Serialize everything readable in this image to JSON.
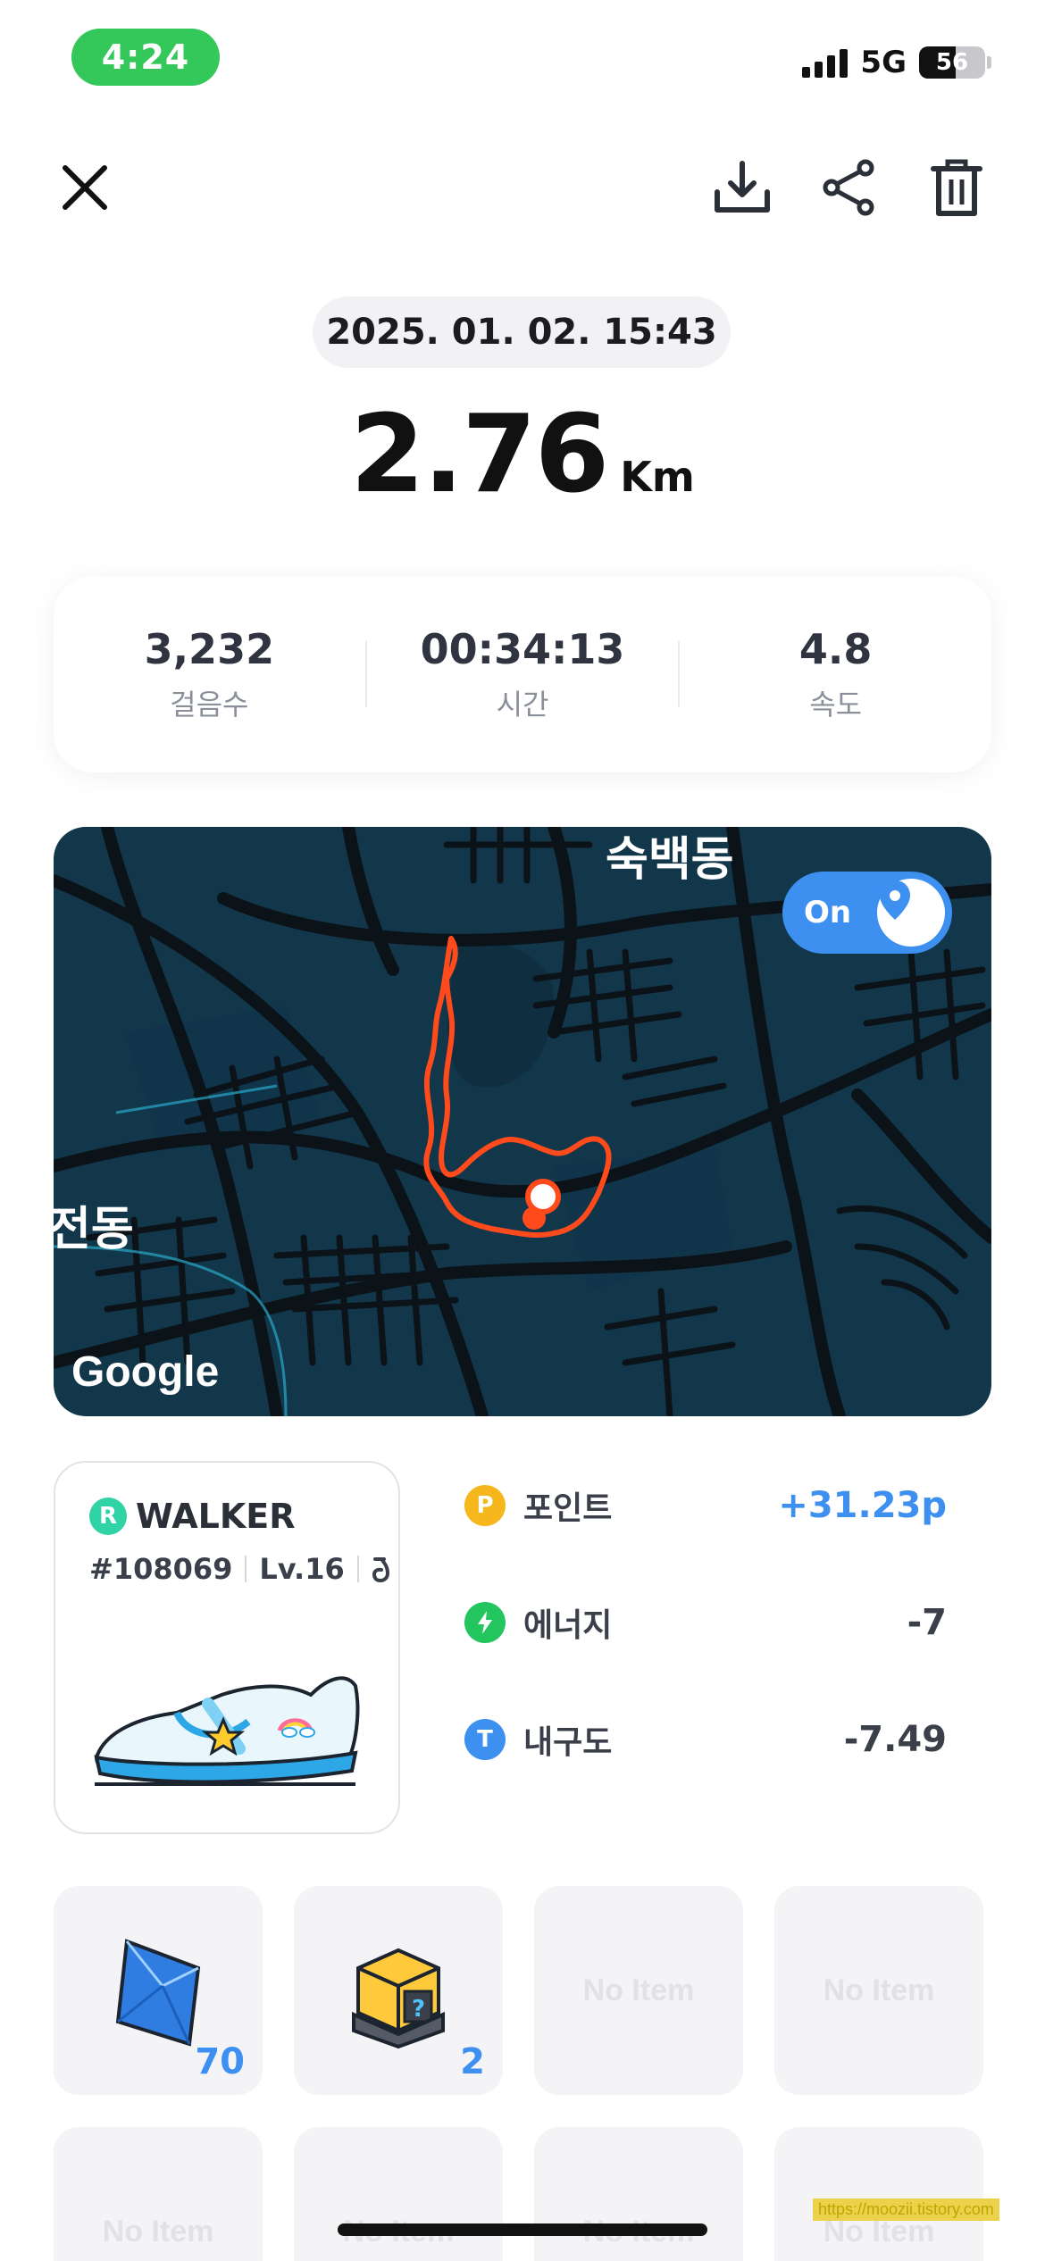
{
  "status_bar": {
    "time": "4:24",
    "network": "5G",
    "battery_percent": "56",
    "battery_level": 0.56
  },
  "toolbar": {
    "close_icon": "close-icon",
    "download_icon": "download-icon",
    "share_icon": "share-icon",
    "delete_icon": "trash-icon"
  },
  "record": {
    "datetime": "2025. 01. 02. 15:43",
    "distance": "2.76",
    "distance_unit": "Km"
  },
  "stats": [
    {
      "value": "3,232",
      "label": "걸음수"
    },
    {
      "value": "00:34:13",
      "label": "시간"
    },
    {
      "value": "4.8",
      "label": "속도"
    }
  ],
  "map": {
    "toggle_label": "On",
    "labels": {
      "top": "숙백동",
      "left": "전동"
    },
    "attribution": "Google",
    "colors": {
      "background": "#12374a",
      "road": "#0b1218",
      "route": "#ff4a1c"
    }
  },
  "sneaker": {
    "rarity_badge": "R",
    "type": "WALKER",
    "id": "#108069",
    "level": "Lv.16",
    "mint_icon": "mint-icon"
  },
  "rewards": [
    {
      "icon": "point-icon",
      "badge": "P",
      "label": "포인트",
      "value": "+31.23p",
      "color": "#f5b71b",
      "highlight": true
    },
    {
      "icon": "energy-icon",
      "badge": "⚡",
      "label": "에너지",
      "value": "-7",
      "color": "#22c55e",
      "highlight": false
    },
    {
      "icon": "durability-icon",
      "badge": "T",
      "label": "내구도",
      "value": "-7.49",
      "color": "#3d8ff0",
      "highlight": false
    }
  ],
  "items": [
    {
      "icon": "gem-icon",
      "count": "70",
      "empty_label": ""
    },
    {
      "icon": "mystery-box-icon",
      "count": "2",
      "empty_label": ""
    },
    {
      "icon": "",
      "count": "",
      "empty_label": "No Item"
    },
    {
      "icon": "",
      "count": "",
      "empty_label": "No Item"
    },
    {
      "icon": "",
      "count": "",
      "empty_label": "No Item"
    },
    {
      "icon": "",
      "count": "",
      "empty_label": "No Item"
    },
    {
      "icon": "",
      "count": "",
      "empty_label": "No Item"
    },
    {
      "icon": "",
      "count": "",
      "empty_label": "No Item"
    }
  ],
  "watermark": "https://moozii.tistory.com"
}
